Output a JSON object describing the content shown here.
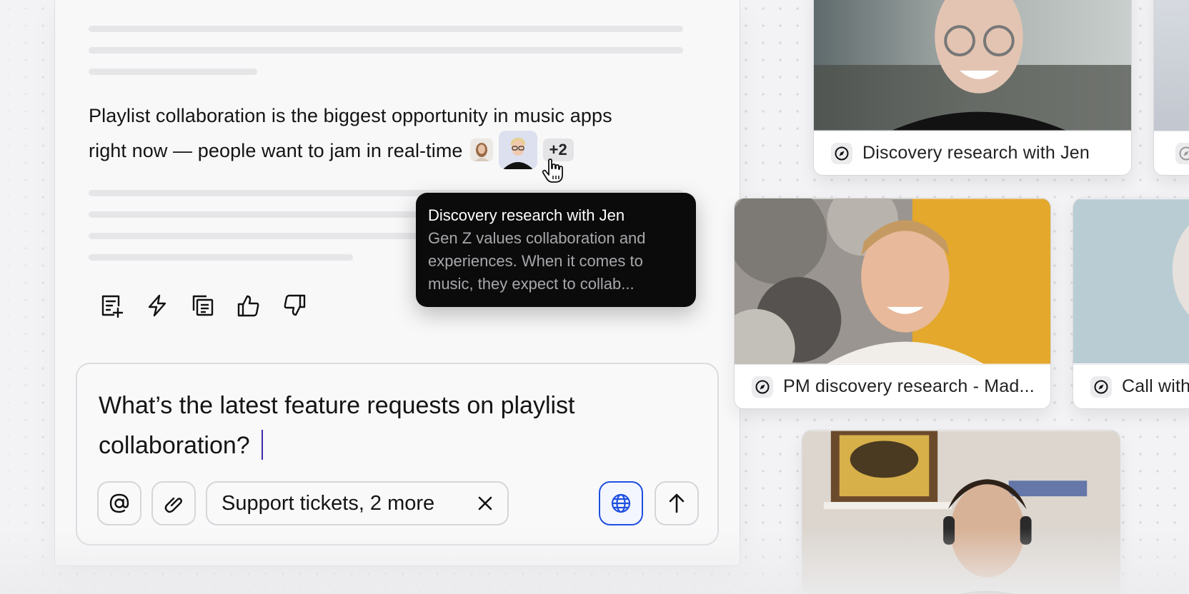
{
  "answer": {
    "line1": "Playlist collaboration is the biggest opportunity in music apps",
    "line2": "right now — people want to jam in real-time",
    "more_sources": "+2"
  },
  "tooltip": {
    "title": "Discovery research with Jen",
    "body_line1": "Gen Z values collaboration and",
    "body_line2": "experiences. When it comes to",
    "body_line3": "music, they expect to collab..."
  },
  "actions": [
    {
      "icon": "add-note-icon"
    },
    {
      "icon": "lightning-icon"
    },
    {
      "icon": "copy-icon"
    },
    {
      "icon": "thumbs-up-icon"
    },
    {
      "icon": "thumbs-down-icon"
    }
  ],
  "composer": {
    "line1": "What’s the latest feature requests on playlist",
    "line2": "collaboration?",
    "mention_icon": "at-icon",
    "attach_icon": "paperclip-icon",
    "source_chip_label": "Support tickets, 2 more",
    "web_search_icon": "globe-icon",
    "send_icon": "arrow-up-icon",
    "accent_color": "#1f4fe0"
  },
  "cards": [
    {
      "label": "Discovery research with Jen",
      "icon": "compass-icon"
    },
    {
      "label": "PM discovery research - Mad...",
      "icon": "compass-icon"
    },
    {
      "label": "Call with",
      "icon": "compass-icon"
    }
  ]
}
